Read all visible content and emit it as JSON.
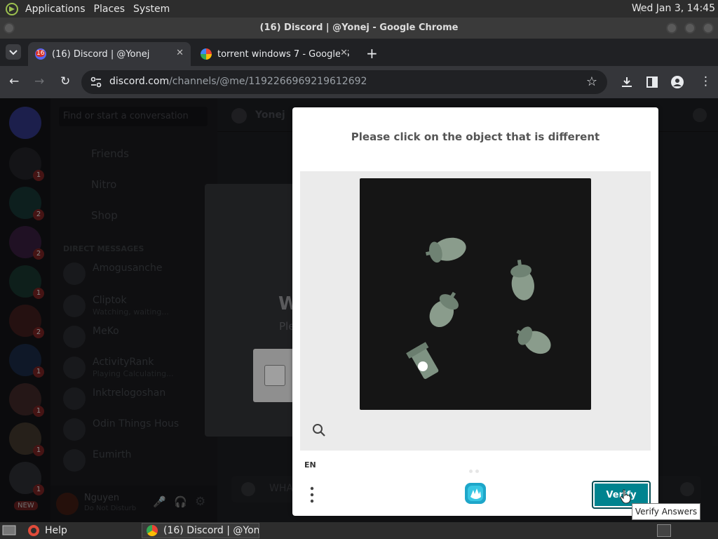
{
  "top_panel": {
    "menus": [
      "Applications",
      "Places",
      "System"
    ],
    "clock": "Wed Jan  3, 14:45"
  },
  "window": {
    "title": "(16) Discord | @Yonej - Google Chrome"
  },
  "tabs": [
    {
      "label": "(16) Discord | @Yonej",
      "badge": "16",
      "active": true
    },
    {
      "label": "torrent windows 7 - Google S",
      "active": false
    }
  ],
  "address_bar": {
    "host": "discord.com",
    "path": "/channels/@me/1192266969219612692"
  },
  "discord": {
    "search_placeholder": "Find or start a conversation",
    "nav": [
      "Friends",
      "Nitro",
      "Shop"
    ],
    "section": "DIRECT MESSAGES",
    "dms": [
      {
        "name": "Amogusanche",
        "status": ""
      },
      {
        "name": "Cliptok",
        "status": "Watching, waiting..."
      },
      {
        "name": "MeKo",
        "status": ""
      },
      {
        "name": "ActivityRank",
        "status": "Playing Calculating..."
      },
      {
        "name": "Inktrelogoshan",
        "status": ""
      },
      {
        "name": "Odin Things Hous",
        "status": ""
      },
      {
        "name": "Eumirth",
        "status": ""
      }
    ],
    "user": {
      "name": "Nguyen",
      "status": "Do Not Disturb"
    },
    "chat_header_name": "Yonej",
    "welcome_heading": "W",
    "welcome_text": "Ple",
    "guild_badges": [
      "1",
      "2",
      "2",
      "1",
      "2",
      "1",
      "1",
      "1",
      "1"
    ],
    "new_badge": "NEW",
    "composer_hint": "WHA"
  },
  "captcha": {
    "prompt": "Please click on the object that is different",
    "language": "EN",
    "verify_label": "Verify",
    "tooltip": "Verify Answers"
  },
  "taskbar": {
    "items": [
      "Help",
      "(16) Discord | @Yon..."
    ]
  },
  "colors": {
    "verify_button": "#00838f",
    "discord_brand": "#5865f2",
    "acorn": "#8a9c8c"
  }
}
